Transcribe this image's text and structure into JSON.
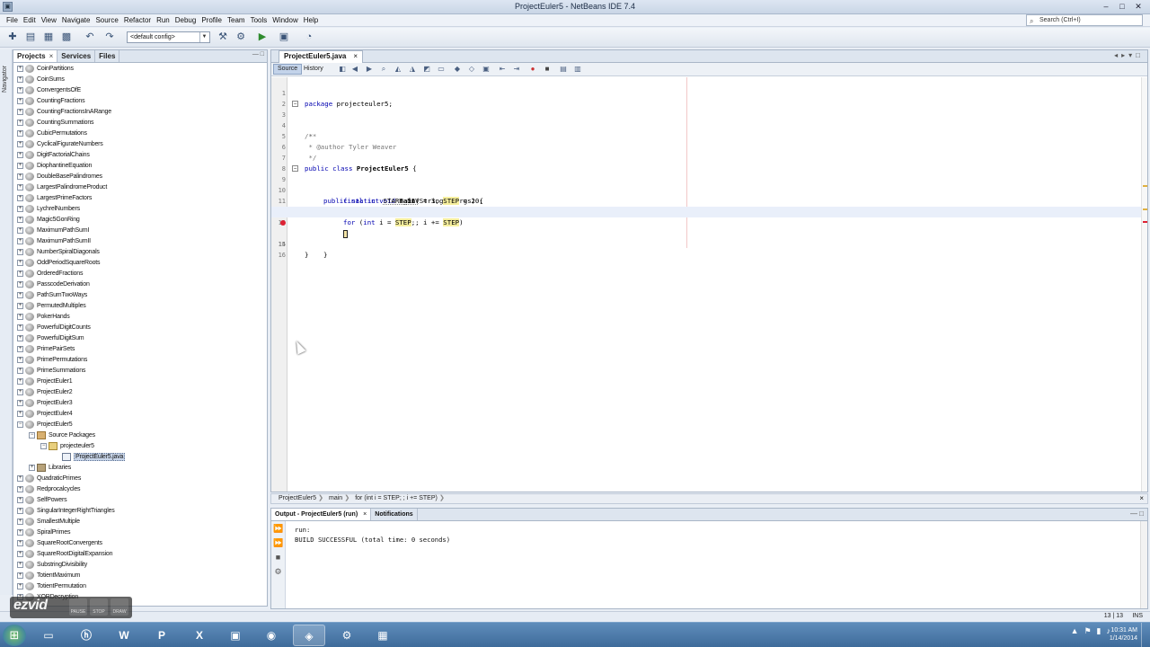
{
  "window": {
    "title": "ProjectEuler5 - NetBeans IDE 7.4",
    "app_icon": "netbeans-cube-icon"
  },
  "menubar": {
    "items": [
      "File",
      "Edit",
      "View",
      "Navigate",
      "Source",
      "Refactor",
      "Run",
      "Debug",
      "Profile",
      "Team",
      "Tools",
      "Window",
      "Help"
    ]
  },
  "search": {
    "placeholder": "Search (Ctrl+I)"
  },
  "toolbar": {
    "config_value": "<default config>"
  },
  "navigator": {
    "label": "Navigator"
  },
  "projects_panel": {
    "tabs": [
      {
        "label": "Projects",
        "close": "×"
      },
      {
        "label": "Services"
      },
      {
        "label": "Files"
      }
    ],
    "items": [
      "CoinPartitions",
      "CoinSums",
      "ConvergentsOfE",
      "CountingFractions",
      "CountingFractionsInARange",
      "CountingSummations",
      "CubicPermutations",
      "CyclicalFigurateNumbers",
      "DigitFactorialChains",
      "DiophantineEquation",
      "DoubleBasePalindromes",
      "LargestPalindromeProduct",
      "LargestPrimeFactors",
      "LychrelNumbers",
      "Magic5GonRing",
      "MaximumPathSumI",
      "MaximumPathSumII",
      "NumberSpiralDiagonals",
      "OddPeriodSquareRoots",
      "OrderedFractions",
      "PasscodeDerivation",
      "PathSumTwoWays",
      "PermutedMultiples",
      "PokerHands",
      "PowerfulDigitCounts",
      "PowerfulDigitSum",
      "PrimePairSets",
      "PrimePermutations",
      "PrimeSummations",
      "ProjectEuler1",
      "ProjectEuler2",
      "ProjectEuler3",
      "ProjectEuler4",
      "ProjectEuler5"
    ],
    "expanded": {
      "source_packages": "Source Packages",
      "package": "projecteuler5",
      "file": "ProjectEuler5.java",
      "libraries": "Libraries"
    },
    "items_after": [
      "QuadraticPrimes",
      "Redprocalcycles",
      "SelfPowers",
      "SingularIntegerRightTriangles",
      "SmallestMultiple",
      "SpiralPrimes",
      "SquareRootConvergents",
      "SquareRootDigitalExpansion",
      "SubstringDivisibility",
      "TotientMaximum",
      "TotientPermutation",
      "XORDecryption"
    ]
  },
  "editor": {
    "tab_label": "ProjectEuler5.java",
    "tab_close": "×",
    "source_label": "Source",
    "history_label": "History",
    "lines": [
      {
        "n": "1"
      },
      {
        "n": "2"
      },
      {
        "n": "3"
      },
      {
        "n": "4"
      },
      {
        "n": "5"
      },
      {
        "n": "6"
      },
      {
        "n": "7"
      },
      {
        "n": "8"
      },
      {
        "n": "9"
      },
      {
        "n": "10"
      },
      {
        "n": "11"
      },
      {
        "n": "12"
      },
      {
        "n": "13"
      },
      {
        "n": "14"
      },
      {
        "n": "15"
      },
      {
        "n": "16"
      }
    ],
    "code": {
      "l1_kw": "package",
      "l1_rest": " projecteuler5;",
      "l3": "/**",
      "l4": " *",
      "l5": " * @author Tyler Weaver",
      "l6": " */",
      "l7_kw": "public class",
      "l7_name": "ProjectEuler5",
      "l7_rest": " {",
      "l9_kw": "public static void",
      "l9_name": "main",
      "l9_rest": "(String[] args) {",
      "l10_kw": "final int",
      "l10_v1": "START_DIV",
      "l10_mid": " = 3, ",
      "l10_v2": "STEP",
      "l10_end": " = 20;",
      "l12_kw": "for",
      "l12_a": " (",
      "l12_kw2": "int",
      "l12_b": " i = ",
      "l12_v1": "STEP",
      "l12_c": ";; i += ",
      "l12_v2": "STEP",
      "l12_d": ")",
      "l14": "}",
      "l15": "}"
    }
  },
  "breadcrumb": {
    "items": [
      "ProjectEuler5",
      "main",
      "for (int i = STEP; ; i += STEP)"
    ],
    "close": "×"
  },
  "output": {
    "tabs": [
      {
        "label": "Output - ProjectEuler5 (run)",
        "close": "×"
      },
      {
        "label": "Notifications"
      }
    ],
    "lines": [
      "run:",
      "BUILD SUCCESSFUL (total time: 0 seconds)"
    ]
  },
  "status": {
    "position": "13 | 13",
    "mode": "INS"
  },
  "ezvid": {
    "logo": "ezvid",
    "buttons": [
      "PAUSE",
      "STOP",
      "DRAW"
    ]
  },
  "taskbar": {
    "time": "10:31 AM",
    "date": "1/14/2014"
  }
}
